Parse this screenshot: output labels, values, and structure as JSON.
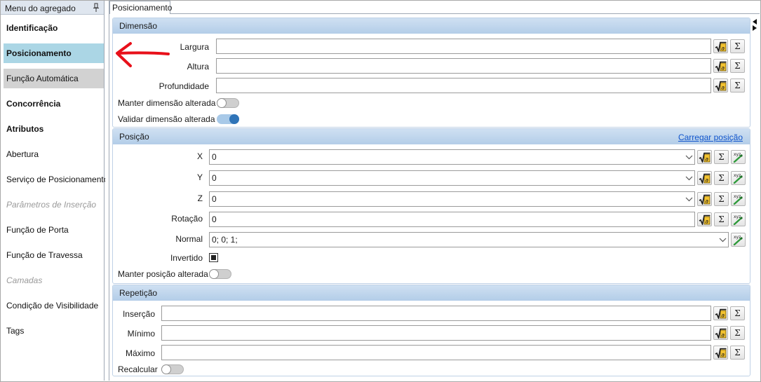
{
  "sidebar": {
    "title": "Menu do agregado",
    "items": [
      {
        "label": "Identificação",
        "style": "bold"
      },
      {
        "label": "Posicionamento",
        "style": "bold active"
      },
      {
        "label": "Função Automática",
        "style": "hover"
      },
      {
        "label": "Concorrência",
        "style": "bold"
      },
      {
        "label": "Atributos",
        "style": "bold"
      },
      {
        "label": "Abertura",
        "style": ""
      },
      {
        "label": "Serviço de Posicionamento",
        "style": ""
      },
      {
        "label": "Parâmetros de Inserção",
        "style": "disabled"
      },
      {
        "label": "Função de Porta",
        "style": ""
      },
      {
        "label": "Função de Travessa",
        "style": ""
      },
      {
        "label": "Camadas",
        "style": "disabled"
      },
      {
        "label": "Condição de Visibilidade",
        "style": ""
      },
      {
        "label": "Tags",
        "style": ""
      }
    ]
  },
  "tab": {
    "label": "Posicionamento"
  },
  "dimensao": {
    "title": "Dimensão",
    "largura": {
      "label": "Largura",
      "value": ""
    },
    "altura": {
      "label": "Altura",
      "value": ""
    },
    "profundidade": {
      "label": "Profundidade",
      "value": ""
    },
    "manter": {
      "label": "Manter dimensão alterada",
      "on": false
    },
    "validar": {
      "label": "Validar dimensão alterada",
      "on": true
    }
  },
  "posicao": {
    "title": "Posição",
    "link": "Carregar posição",
    "x": {
      "label": "X",
      "value": "0"
    },
    "y": {
      "label": "Y",
      "value": "0"
    },
    "z": {
      "label": "Z",
      "value": "0"
    },
    "rotacao": {
      "label": "Rotação",
      "value": "0"
    },
    "normal": {
      "label": "Normal",
      "value": "0; 0; 1;"
    },
    "invertido": {
      "label": "Invertido",
      "checked": true
    },
    "manter": {
      "label": "Manter posição alterada",
      "on": false
    }
  },
  "repeticao": {
    "title": "Repetição",
    "insercao": {
      "label": "Inserção",
      "value": ""
    },
    "minimo": {
      "label": "Mínimo",
      "value": ""
    },
    "maximo": {
      "label": "Máximo",
      "value": ""
    },
    "recalcular": {
      "label": "Recalcular",
      "on": false
    }
  },
  "icons": {
    "formula": "square-root-icon",
    "sum": "sigma-icon",
    "pick": "xyz-pick-icon",
    "pin": "pin-icon",
    "annotation": "red-arrow-icon"
  },
  "colors": {
    "active_item": "#abd6e5",
    "hover_item": "#d2d2d2",
    "group_header": "#b3cde8",
    "toggle_on": "#2f74b8",
    "link": "#1155cc",
    "annotation_arrow": "#e8101a"
  },
  "sigma_glyph": "Σ"
}
